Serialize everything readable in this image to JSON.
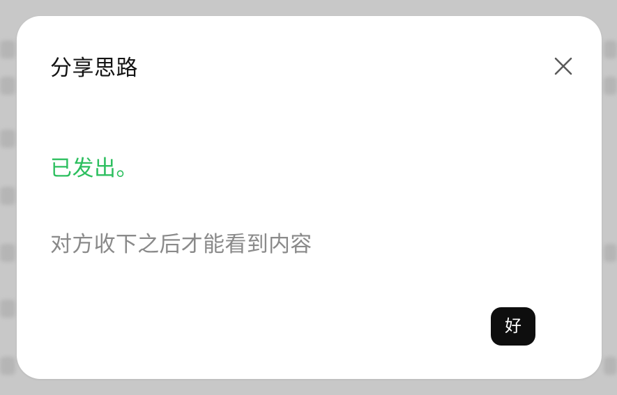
{
  "dialog": {
    "title": "分享思路",
    "status": "已发出。",
    "message": "对方收下之后才能看到内容",
    "ok_label": "好",
    "close_icon": "close-icon"
  },
  "colors": {
    "status_green": "#2dbf5f",
    "message_gray": "#8a8a8a",
    "title_text": "#141414",
    "button_bg": "#0e0e0e",
    "button_text": "#ffffff",
    "close_icon": "#5a5a5a"
  }
}
